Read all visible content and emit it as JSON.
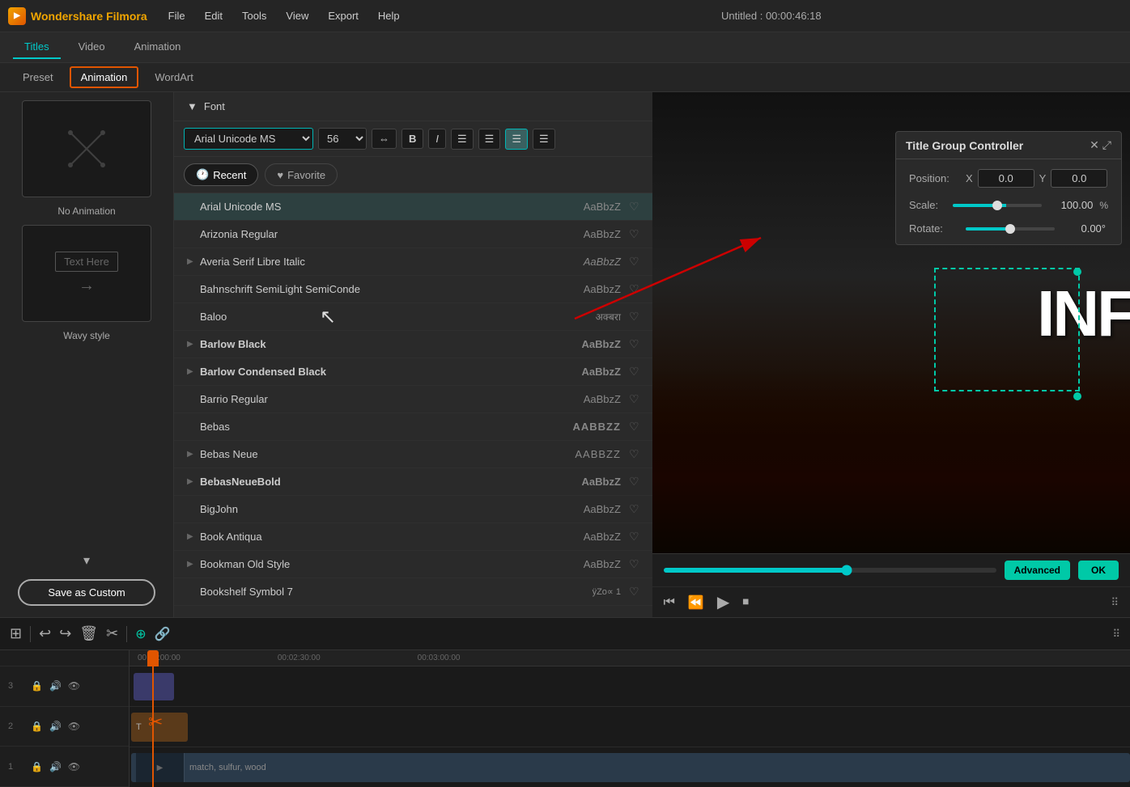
{
  "app": {
    "name": "Wondershare Filmora",
    "title": "Untitled : 00:00:46:18"
  },
  "menu": {
    "items": [
      "File",
      "Edit",
      "Tools",
      "View",
      "Export",
      "Help"
    ]
  },
  "tabs": {
    "main": [
      "Titles",
      "Video",
      "Animation"
    ],
    "active_main": "Titles",
    "sub": [
      "Preset",
      "Animation",
      "WordArt"
    ],
    "active_sub": "Animation"
  },
  "left_panel": {
    "animation1_label": "No Animation",
    "animation2_label": "Wavy style",
    "text_preview": "Text Here",
    "save_btn": "Save as Custom"
  },
  "font_panel": {
    "header": "Font",
    "selected_font": "Arial Unicode MS",
    "font_size": "56",
    "filters": {
      "recent": "Recent",
      "favorite": "Favorite"
    },
    "fonts": [
      {
        "name": "Arial Unicode MS",
        "preview": "AaBbzZ",
        "style": "normal",
        "selected": true,
        "expandable": false
      },
      {
        "name": "Arizonia Regular",
        "preview": "AaBbzZ",
        "style": "normal",
        "selected": false,
        "expandable": false
      },
      {
        "name": "Averia Serif Libre Italic",
        "preview": "AaBbzZ",
        "style": "italic",
        "selected": false,
        "expandable": true
      },
      {
        "name": "Bahnschrift SemiLight SemiConde",
        "preview": "AaBbzZ",
        "style": "normal",
        "selected": false,
        "expandable": false
      },
      {
        "name": "Baloo",
        "preview": "अक्बरा",
        "style": "devanagari",
        "selected": false,
        "expandable": false
      },
      {
        "name": "Barlow Black",
        "preview": "AaBbzZ",
        "style": "bold",
        "selected": false,
        "expandable": true
      },
      {
        "name": "Barlow Condensed Black",
        "preview": "AaBbzZ",
        "style": "bold",
        "selected": false,
        "expandable": true
      },
      {
        "name": "Barrio Regular",
        "preview": "AaBbzZ",
        "style": "normal",
        "selected": false,
        "expandable": false
      },
      {
        "name": "Bebas",
        "preview": "AABBZZ",
        "style": "bold",
        "selected": false,
        "expandable": false
      },
      {
        "name": "Bebas Neue",
        "preview": "AABBZZ",
        "style": "normal",
        "selected": false,
        "expandable": true
      },
      {
        "name": "BebasNeueBold",
        "preview": "AaBbzZ",
        "style": "bold",
        "selected": false,
        "expandable": true
      },
      {
        "name": "BigJohn",
        "preview": "AaBbzZ",
        "style": "normal",
        "selected": false,
        "expandable": false
      },
      {
        "name": "Book Antiqua",
        "preview": "AaBbzZ",
        "style": "normal",
        "selected": false,
        "expandable": true
      },
      {
        "name": "Bookman Old Style",
        "preview": "AaBbzZ",
        "style": "normal",
        "selected": false,
        "expandable": true
      },
      {
        "name": "Bookshelf Symbol 7",
        "preview": "ÿZo∝ 1",
        "style": "normal",
        "selected": false,
        "expandable": false
      }
    ],
    "toolbar": {
      "bold": "B",
      "italic": "I",
      "spacing_icon": "⇔",
      "align_left": "≡",
      "align_center": "≡",
      "align_right": "≡",
      "align_justify": "≡"
    }
  },
  "tgc": {
    "title": "Title Group Controller",
    "position_label": "Position:",
    "x_label": "X",
    "x_value": "0.0",
    "y_label": "Y",
    "y_value": "0.0",
    "scale_label": "Scale:",
    "scale_value": "100.00",
    "scale_unit": "%",
    "rotate_label": "Rotate:",
    "rotate_value": "0.00°"
  },
  "preview": {
    "text": "INF",
    "advanced_btn": "Advanced",
    "ok_btn": "OK"
  },
  "timeline": {
    "ruler_marks": [
      "00:02:00:00",
      "00:02:30:00",
      "00:03:00:00"
    ],
    "tracks": [
      {
        "num": "3",
        "label": ""
      },
      {
        "num": "2",
        "label": ""
      },
      {
        "num": "1",
        "label": ""
      }
    ],
    "clip_label": "match, sulfur, wood"
  }
}
